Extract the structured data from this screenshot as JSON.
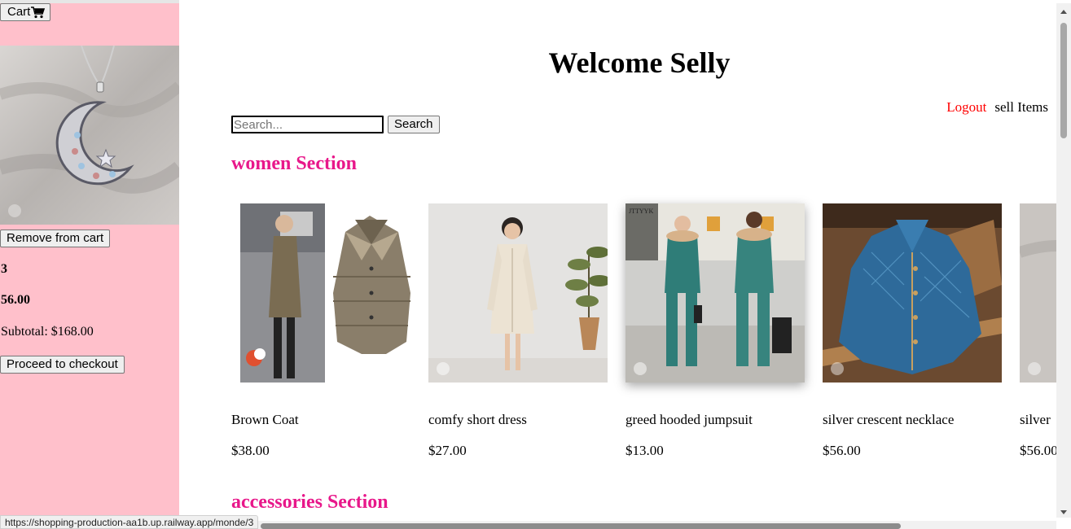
{
  "sidebar": {
    "cart_label": "Cart",
    "remove_label": "Remove from cart",
    "quantity": "3",
    "price": "56.00",
    "subtotal": "Subtotal: $168.00",
    "checkout_label": "Proceed to checkout",
    "background_color": "#ffc0cb"
  },
  "header": {
    "title": "Welcome Selly",
    "logout_label": "Logout",
    "sell_label": "sell Items"
  },
  "search": {
    "placeholder": "Search...",
    "value": "",
    "button_label": "Search"
  },
  "sections": {
    "women_title": "women Section",
    "accessories_title": "accessories Section",
    "title_color": "#e8178a"
  },
  "products": [
    {
      "name": "Brown Coat",
      "price": "$38.00"
    },
    {
      "name": "comfy short dress",
      "price": "$27.00"
    },
    {
      "name": "greed hooded jumpsuit",
      "price": "$13.00"
    },
    {
      "name": "silver crescent necklace",
      "price": "$56.00"
    },
    {
      "name": "silver",
      "price": "$56.00"
    }
  ],
  "image_text": {
    "jumpsuit_brand": "JTTYYK"
  },
  "status_bar": {
    "url": "https://shopping-production-aa1b.up.railway.app/monde/3"
  },
  "icons": {
    "cart": "cart-icon"
  }
}
